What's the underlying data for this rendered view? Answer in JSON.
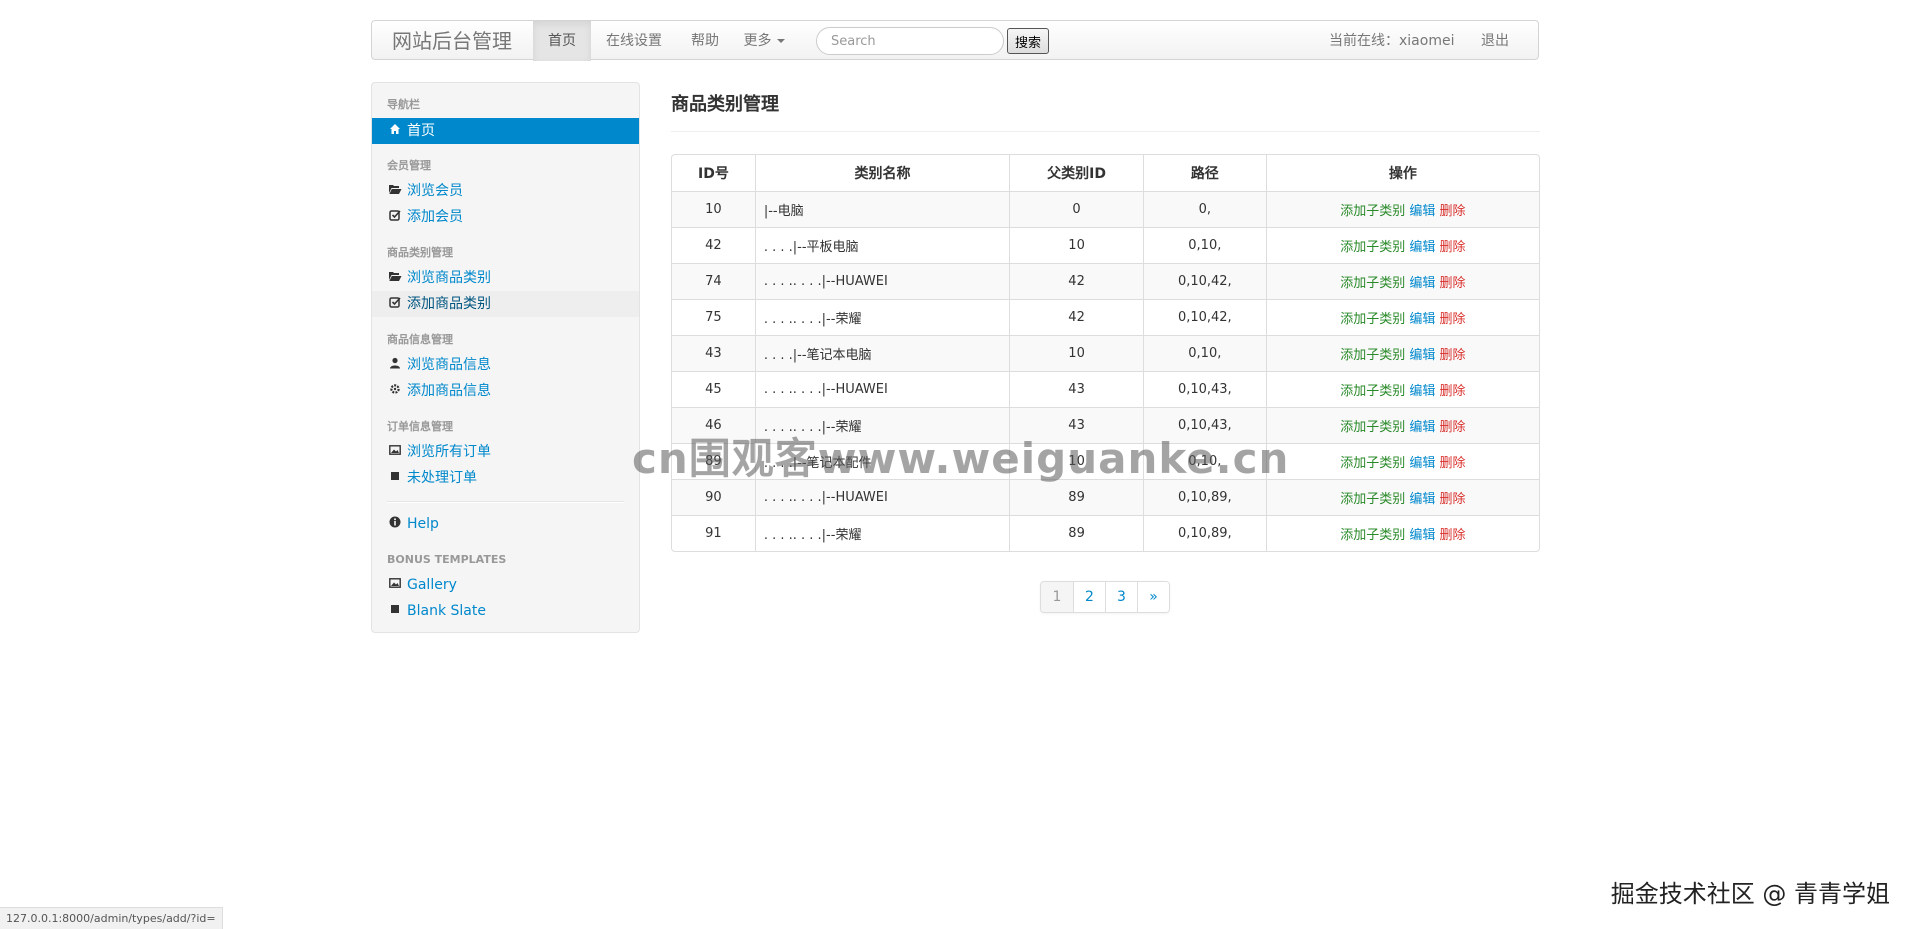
{
  "navbar": {
    "brand": "网站后台管理",
    "items": [
      {
        "label": "首页",
        "active": true
      },
      {
        "label": "在线设置",
        "active": false
      },
      {
        "label": "帮助",
        "active": false
      },
      {
        "label": "更多",
        "active": false
      }
    ],
    "search_placeholder": "Search",
    "search_button": "搜索",
    "online_text": "当前在线：xiaomei",
    "logout": "退出"
  },
  "sidebar": {
    "groups": [
      {
        "header": "导航栏",
        "items": [
          {
            "label": "首页",
            "icon": "home-icon",
            "active": true
          }
        ]
      },
      {
        "header": "会员管理",
        "items": [
          {
            "label": "浏览会员",
            "icon": "folder-open-icon"
          },
          {
            "label": "添加会员",
            "icon": "check-square-icon"
          }
        ]
      },
      {
        "header": "商品类别管理",
        "items": [
          {
            "label": "浏览商品类别",
            "icon": "folder-open-icon"
          },
          {
            "label": "添加商品类别",
            "icon": "check-square-icon",
            "hover": true
          }
        ]
      },
      {
        "header": "商品信息管理",
        "items": [
          {
            "label": "浏览商品信息",
            "icon": "user-icon"
          },
          {
            "label": "添加商品信息",
            "icon": "cog-icon"
          }
        ]
      },
      {
        "header": "订单信息管理",
        "items": [
          {
            "label": "浏览所有订单",
            "icon": "picture-icon"
          },
          {
            "label": "未处理订单",
            "icon": "stop-icon"
          }
        ]
      }
    ],
    "help": {
      "label": "Help",
      "icon": "info-icon"
    },
    "bonus_header": "BONUS TEMPLATES",
    "bonus_items": [
      {
        "label": "Gallery",
        "icon": "picture-icon"
      },
      {
        "label": "Blank Slate",
        "icon": "stop-icon"
      }
    ]
  },
  "main": {
    "title": "商品类别管理",
    "table": {
      "columns": [
        "ID号",
        "类别名称",
        "父类别ID",
        "路径",
        "操作"
      ],
      "rows": [
        {
          "id": "10",
          "name": "|--电脑",
          "pid": "0",
          "path": "0,"
        },
        {
          "id": "42",
          "name": ". . . .|--平板电脑",
          "pid": "10",
          "path": "0,10,"
        },
        {
          "id": "74",
          "name": ". . . .. . . .|--HUAWEI",
          "pid": "42",
          "path": "0,10,42,"
        },
        {
          "id": "75",
          "name": ". . . .. . . .|--荣耀",
          "pid": "42",
          "path": "0,10,42,"
        },
        {
          "id": "43",
          "name": ". . . .|--笔记本电脑",
          "pid": "10",
          "path": "0,10,"
        },
        {
          "id": "45",
          "name": ". . . .. . . .|--HUAWEI",
          "pid": "43",
          "path": "0,10,43,"
        },
        {
          "id": "46",
          "name": ". . . .. . . .|--荣耀",
          "pid": "43",
          "path": "0,10,43,"
        },
        {
          "id": "89",
          "name": ". . . .|--笔记本配件",
          "pid": "10",
          "path": "0,10,"
        },
        {
          "id": "90",
          "name": ". . . .. . . .|--HUAWEI",
          "pid": "89",
          "path": "0,10,89,"
        },
        {
          "id": "91",
          "name": ". . . .. . . .|--荣耀",
          "pid": "89",
          "path": "0,10,89,"
        }
      ],
      "actions": {
        "add": "添加子类别",
        "edit": "编辑",
        "delete": "删除"
      }
    },
    "pagination": {
      "pages": [
        "1",
        "2",
        "3"
      ],
      "current": "1",
      "next": "»"
    }
  },
  "overlay": {
    "watermark": "cn围观客www.weiguanke.cn",
    "status_url": "127.0.0.1:8000/admin/types/add/?id=",
    "credit": "掘金技术社区 @ 青青学姐"
  },
  "colors": {
    "accent": "#0088cc",
    "add": "#2a8a2a",
    "delete": "#d9302c"
  }
}
